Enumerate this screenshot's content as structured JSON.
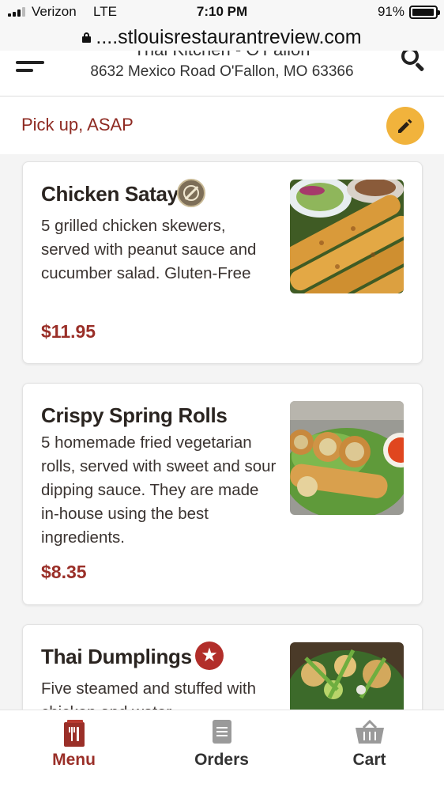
{
  "status_bar": {
    "carrier": "Verizon",
    "network": "LTE",
    "time": "7:10 PM",
    "battery": "91%"
  },
  "browser": {
    "url": "....stlouisrestaurantreview.com"
  },
  "restaurant": {
    "name": "Thai Kitchen - O'Fallon",
    "address": "8632 Mexico Road O'Fallon, MO 63366"
  },
  "order_mode": {
    "label": "Pick up, ASAP"
  },
  "menu_items": [
    {
      "title": "Chicken Satay",
      "description": "5 grilled chicken skewers, served with peanut sauce and cucumber salad. Gluten-Free",
      "price": "$11.95",
      "badge": "gluten-free-icon"
    },
    {
      "title": "Crispy Spring Rolls",
      "description": "5 homemade fried vegetarian rolls, served with sweet and sour dipping sauce. They are made in-house using the best ingredients.",
      "price": "$8.35",
      "badge": ""
    },
    {
      "title": "Thai Dumplings",
      "description": "Five steamed and stuffed with chicken and water",
      "price": "",
      "badge": "star-icon"
    }
  ],
  "tabs": [
    {
      "label": "Menu",
      "icon": "menu-utensils-icon",
      "active": true
    },
    {
      "label": "Orders",
      "icon": "orders-icon",
      "active": false
    },
    {
      "label": "Cart",
      "icon": "basket-icon",
      "active": false
    }
  ],
  "colors": {
    "accent": "#9a2f28",
    "edit_button": "#f1b33c",
    "list_background": "#f4f4f4"
  }
}
